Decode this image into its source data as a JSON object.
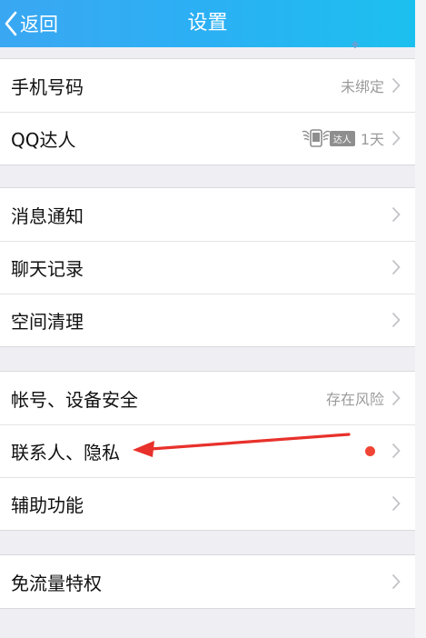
{
  "navbar": {
    "back_label": "返回",
    "title": "设置"
  },
  "groups": [
    {
      "rows": [
        {
          "label": "手机号码",
          "value": "未绑定"
        },
        {
          "label": "QQ达人",
          "badge": "达人",
          "value": "1天"
        }
      ]
    },
    {
      "rows": [
        {
          "label": "消息通知"
        },
        {
          "label": "聊天记录"
        },
        {
          "label": "空间清理"
        }
      ]
    },
    {
      "rows": [
        {
          "label": "帐号、设备安全",
          "value": "存在风险"
        },
        {
          "label": "联系人、隐私",
          "dot": true
        },
        {
          "label": "辅助功能"
        }
      ]
    },
    {
      "rows": [
        {
          "label": "免流量特权"
        }
      ]
    }
  ],
  "icons": {
    "back": "chevron-left-icon",
    "row_arrow": "chevron-right-icon",
    "talent": "winged-phone-icon",
    "notification": "red-dot-icon"
  },
  "colors": {
    "navbar_start": "#3aa7f2",
    "navbar_end": "#1cc0ef",
    "annotation_arrow": "#e8312b",
    "dot": "#f04535"
  }
}
